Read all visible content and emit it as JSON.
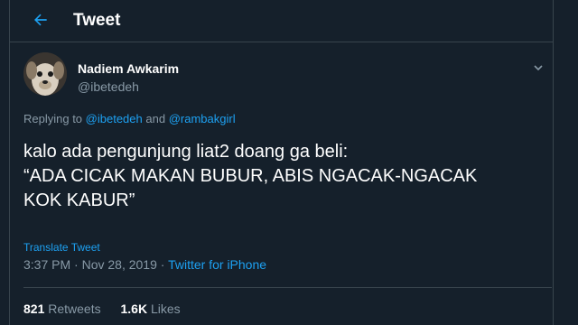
{
  "header": {
    "title": "Tweet"
  },
  "author": {
    "name": "Nadiem Awkarim",
    "handle": "@ibetedeh"
  },
  "reply": {
    "prefix": "Replying to",
    "mention1": "@ibetedeh",
    "conj": "and",
    "mention2": "@rambakgirl"
  },
  "tweet": {
    "lines": [
      "kalo ada pengunjung liat2 doang ga beli:",
      "“ADA CICAK MAKAN BUBUR, ABIS NGACAK-NGACAK",
      "KOK KABUR”"
    ]
  },
  "translate_label": "Translate Tweet",
  "meta": {
    "time": "3:37 PM",
    "sep": "·",
    "date": "Nov 28, 2019",
    "source": "Twitter for iPhone"
  },
  "stats": {
    "retweets": "821",
    "retweets_label": "Retweets",
    "likes": "1.6K",
    "likes_label": "Likes"
  },
  "icons": {
    "back": "arrow-left-icon",
    "caret": "chevron-down-icon"
  },
  "colors": {
    "background": "#15202b",
    "accent": "#1da1f2",
    "muted": "#8899a6",
    "border": "#38444d"
  }
}
